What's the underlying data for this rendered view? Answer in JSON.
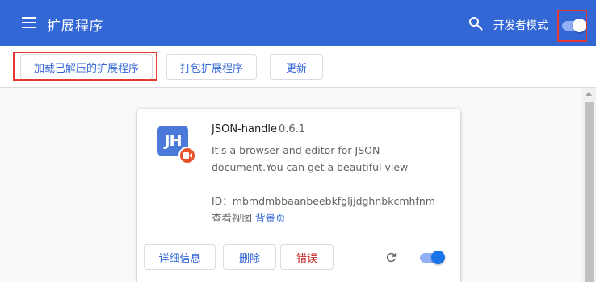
{
  "header": {
    "title": "扩展程序",
    "search_icon": "search-icon",
    "dev_mode_label": "开发者模式",
    "dev_mode_enabled": true,
    "color": "#3367d6"
  },
  "toolbar": {
    "load_unpacked_label": "加载已解压的扩展程序",
    "pack_extension_label": "打包扩展程序",
    "update_label": "更新"
  },
  "extension": {
    "name": "JSON-handle",
    "version": "0.6.1",
    "icon_text": "JH",
    "description": "It's a browser and editor for JSON document.You can get a beautiful view",
    "id_text": "ID：mbmdmbbaanbeebkfgljjdghnbkcmhfnm",
    "inspect_views_label": "查看视图",
    "background_page_link": "背景页",
    "details_label": "详细信息",
    "remove_label": "删除",
    "errors_label": "错误",
    "enabled": true,
    "errors_color": "#c5221f"
  }
}
